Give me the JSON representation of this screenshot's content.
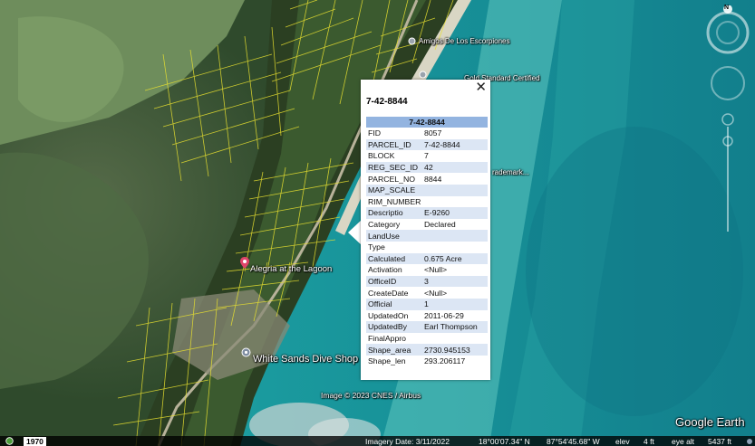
{
  "popup": {
    "title": "7-42-8844",
    "table_header": "7-42-8844",
    "close_glyph": "✕",
    "rows": [
      {
        "key": "FID",
        "value": "8057"
      },
      {
        "key": "PARCEL_ID",
        "value": "7-42-8844"
      },
      {
        "key": "BLOCK",
        "value": "7"
      },
      {
        "key": "REG_SEC_ID",
        "value": "42"
      },
      {
        "key": "PARCEL_NO",
        "value": "8844"
      },
      {
        "key": "MAP_SCALE",
        "value": ""
      },
      {
        "key": "RIM_NUMBER",
        "value": ""
      },
      {
        "key": "Descriptio",
        "value": "E-9260"
      },
      {
        "key": "Category",
        "value": "Declared"
      },
      {
        "key": "LandUse",
        "value": ""
      },
      {
        "key": "Type",
        "value": ""
      },
      {
        "key": "Calculated",
        "value": "0.675 Acre"
      },
      {
        "key": "Activation",
        "value": "<Null>"
      },
      {
        "key": "OfficeID",
        "value": "3"
      },
      {
        "key": "CreateDate",
        "value": "<Null>"
      },
      {
        "key": "Official",
        "value": "1"
      },
      {
        "key": "UpdatedOn",
        "value": "2011-06-29"
      },
      {
        "key": "UpdatedBy",
        "value": "Earl Thompson"
      },
      {
        "key": "FinalAppro",
        "value": ""
      },
      {
        "key": "Shape_area",
        "value": "2730.945153"
      },
      {
        "key": "Shape_len",
        "value": "293.206117"
      }
    ]
  },
  "places": {
    "amigos": "Amigos De Los Escorpiones",
    "gold_standard": "Gold Standard Certified",
    "trademark": "rademark...",
    "alegria": "Alegria at the Lagoon",
    "white_sands": "White Sands Dive Shop"
  },
  "attribution": {
    "imagery": "Image © 2023 CNES / Airbus",
    "brand": "Google Earth"
  },
  "status": {
    "year": "1970",
    "imagery_date": "Imagery Date: 3/11/2022",
    "lat": "18°00'07.34\" N",
    "lon": "87°54'45.68\" W",
    "elev": "elev",
    "elev_value": "4 ft",
    "eye_alt": "eye alt",
    "eye_alt_value": "5437 ft"
  },
  "compass": {
    "north": "N"
  },
  "colors": {
    "parcel_lines": "#e8e030",
    "table_header": "#93b4e0",
    "row_alt": "#dce6f4",
    "pin_red": "#e0446a"
  }
}
